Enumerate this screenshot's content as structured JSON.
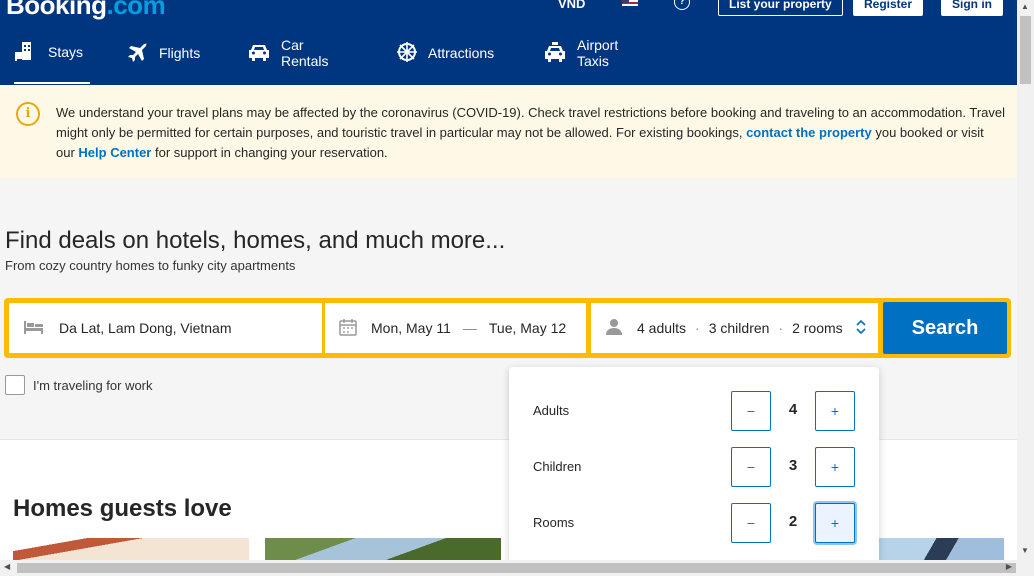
{
  "header": {
    "logo_main": "Booking",
    "logo_dot": ".com",
    "currency": "VND",
    "help": "?",
    "list_property": "List your property",
    "register": "Register",
    "sign_in": "Sign in",
    "nav": [
      {
        "label": "Stays",
        "icon": "bed-building-icon",
        "active": true
      },
      {
        "label": "Flights",
        "icon": "airplane-icon",
        "active": false
      },
      {
        "label": "Car Rentals",
        "icon": "car-icon",
        "active": false
      },
      {
        "label": "Attractions",
        "icon": "attractions-icon",
        "active": false
      },
      {
        "label": "Airport Taxis",
        "icon": "taxi-icon",
        "active": false
      }
    ]
  },
  "banner": {
    "text_part1": "We understand your travel plans may be affected by the coronavirus (COVID-19). Check travel restrictions before booking and traveling to an accommodation. Travel might only be permitted for certain purposes, and touristic travel in particular may not be allowed. For existing bookings, ",
    "link1": "contact the property",
    "text_part2": " you booked or visit our ",
    "link2": "Help Center",
    "text_part3": " for support in changing your reservation."
  },
  "hero": {
    "title": "Find deals on hotels, homes, and much more...",
    "subtitle": "From cozy country homes to funky city apartments"
  },
  "search": {
    "destination": "Da Lat, Lam Dong, Vietnam",
    "checkin": "Mon, May 11",
    "date_sep": "—",
    "checkout": "Tue, May 12",
    "adults_summary": "4 adults",
    "children_summary": "3 children",
    "rooms_summary": "2 rooms",
    "dot": "·",
    "button": "Search"
  },
  "work_checkbox": "I'm traveling for work",
  "guests_popup": {
    "adults": {
      "label": "Adults",
      "value": "4"
    },
    "children": {
      "label": "Children",
      "value": "3"
    },
    "rooms": {
      "label": "Rooms",
      "value": "2"
    },
    "minus": "−",
    "plus": "+"
  },
  "section_title": "Homes guests love",
  "colors": {
    "brand": "#003580",
    "accent": "#0071c2",
    "search_border": "#febb02"
  }
}
